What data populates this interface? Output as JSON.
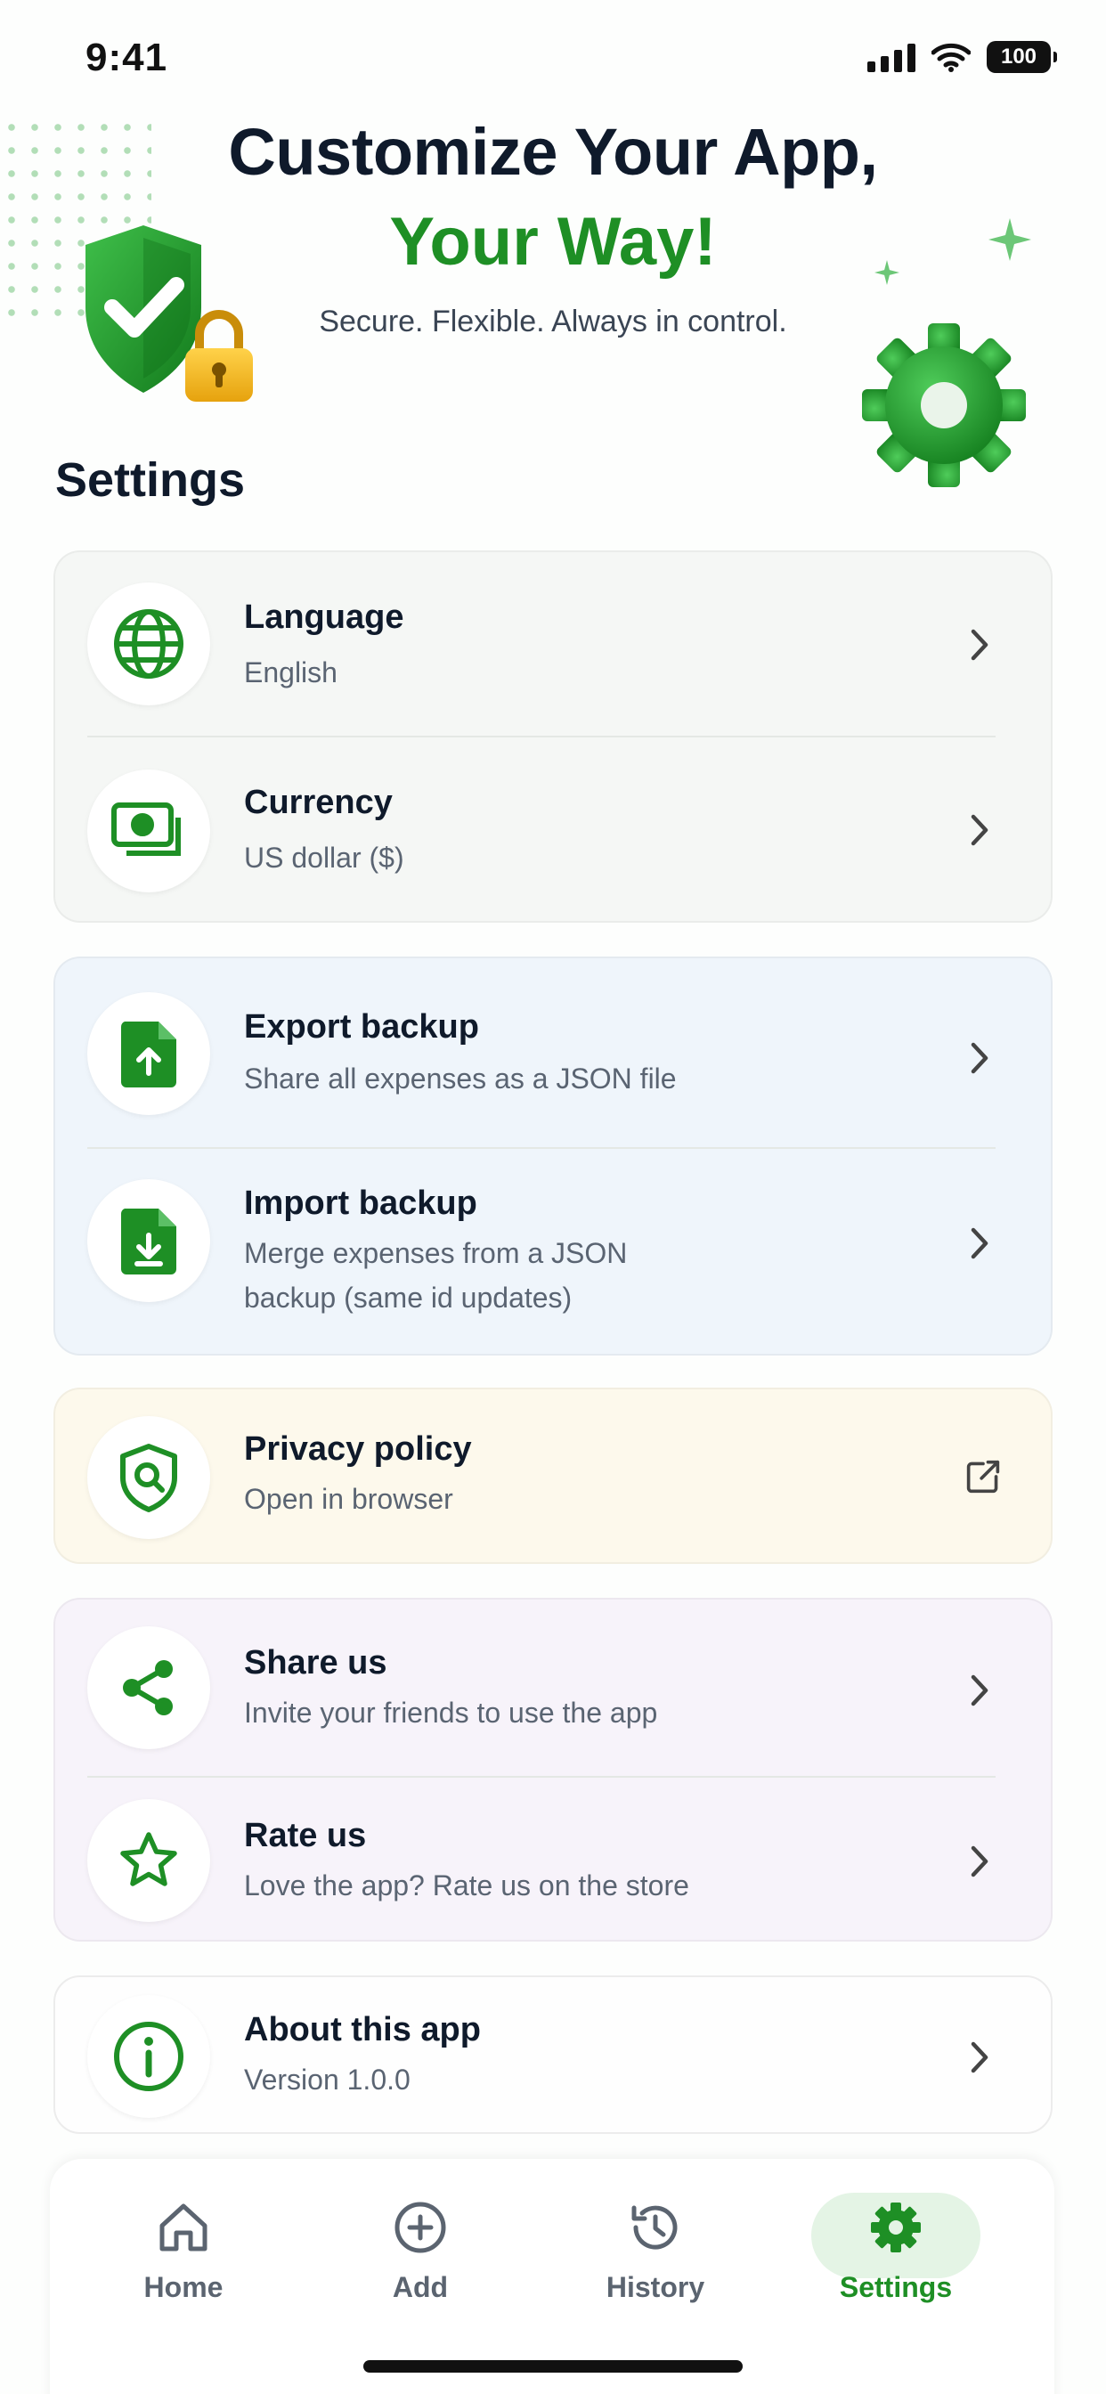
{
  "status_bar": {
    "time": "9:41",
    "battery": "100"
  },
  "hero": {
    "title": "Customize Your App,",
    "accent": "Your Way!",
    "subtitle": "Secure. Flexible. Always in control."
  },
  "section_title": "Settings",
  "groups": {
    "preferences": {
      "language": {
        "title": "Language",
        "value": "English",
        "icon": "globe-icon"
      },
      "currency": {
        "title": "Currency",
        "value": "US dollar ($)",
        "icon": "cash-icon"
      }
    },
    "backup": {
      "export": {
        "title": "Export backup",
        "subtitle": "Share all expenses as a JSON file",
        "icon": "file-upload-icon"
      },
      "import": {
        "title": "Import backup",
        "subtitle_line1": "Merge expenses from a JSON",
        "subtitle_line2": "backup (same id updates)",
        "icon": "file-download-icon"
      }
    },
    "privacy": {
      "policy": {
        "title": "Privacy policy",
        "subtitle": "Open in browser",
        "icon": "shield-search-icon"
      }
    },
    "social": {
      "share": {
        "title": "Share us",
        "subtitle": "Invite your friends to use the app",
        "icon": "share-icon"
      },
      "rate": {
        "title": "Rate us",
        "subtitle": "Love the app? Rate us on the store",
        "icon": "star-icon"
      }
    },
    "about": {
      "app": {
        "title": "About this app",
        "subtitle": "Version 1.0.0",
        "icon": "info-icon"
      }
    }
  },
  "tab_bar": {
    "tabs": [
      {
        "label": "Home",
        "icon": "home-icon",
        "active": false
      },
      {
        "label": "Add",
        "icon": "plus-circle-icon",
        "active": false
      },
      {
        "label": "History",
        "icon": "history-icon",
        "active": false
      },
      {
        "label": "Settings",
        "icon": "gear-icon",
        "active": true
      }
    ]
  },
  "colors": {
    "accent": "#1e8f25",
    "text": "#0f1a2b",
    "muted": "#5a6472"
  }
}
